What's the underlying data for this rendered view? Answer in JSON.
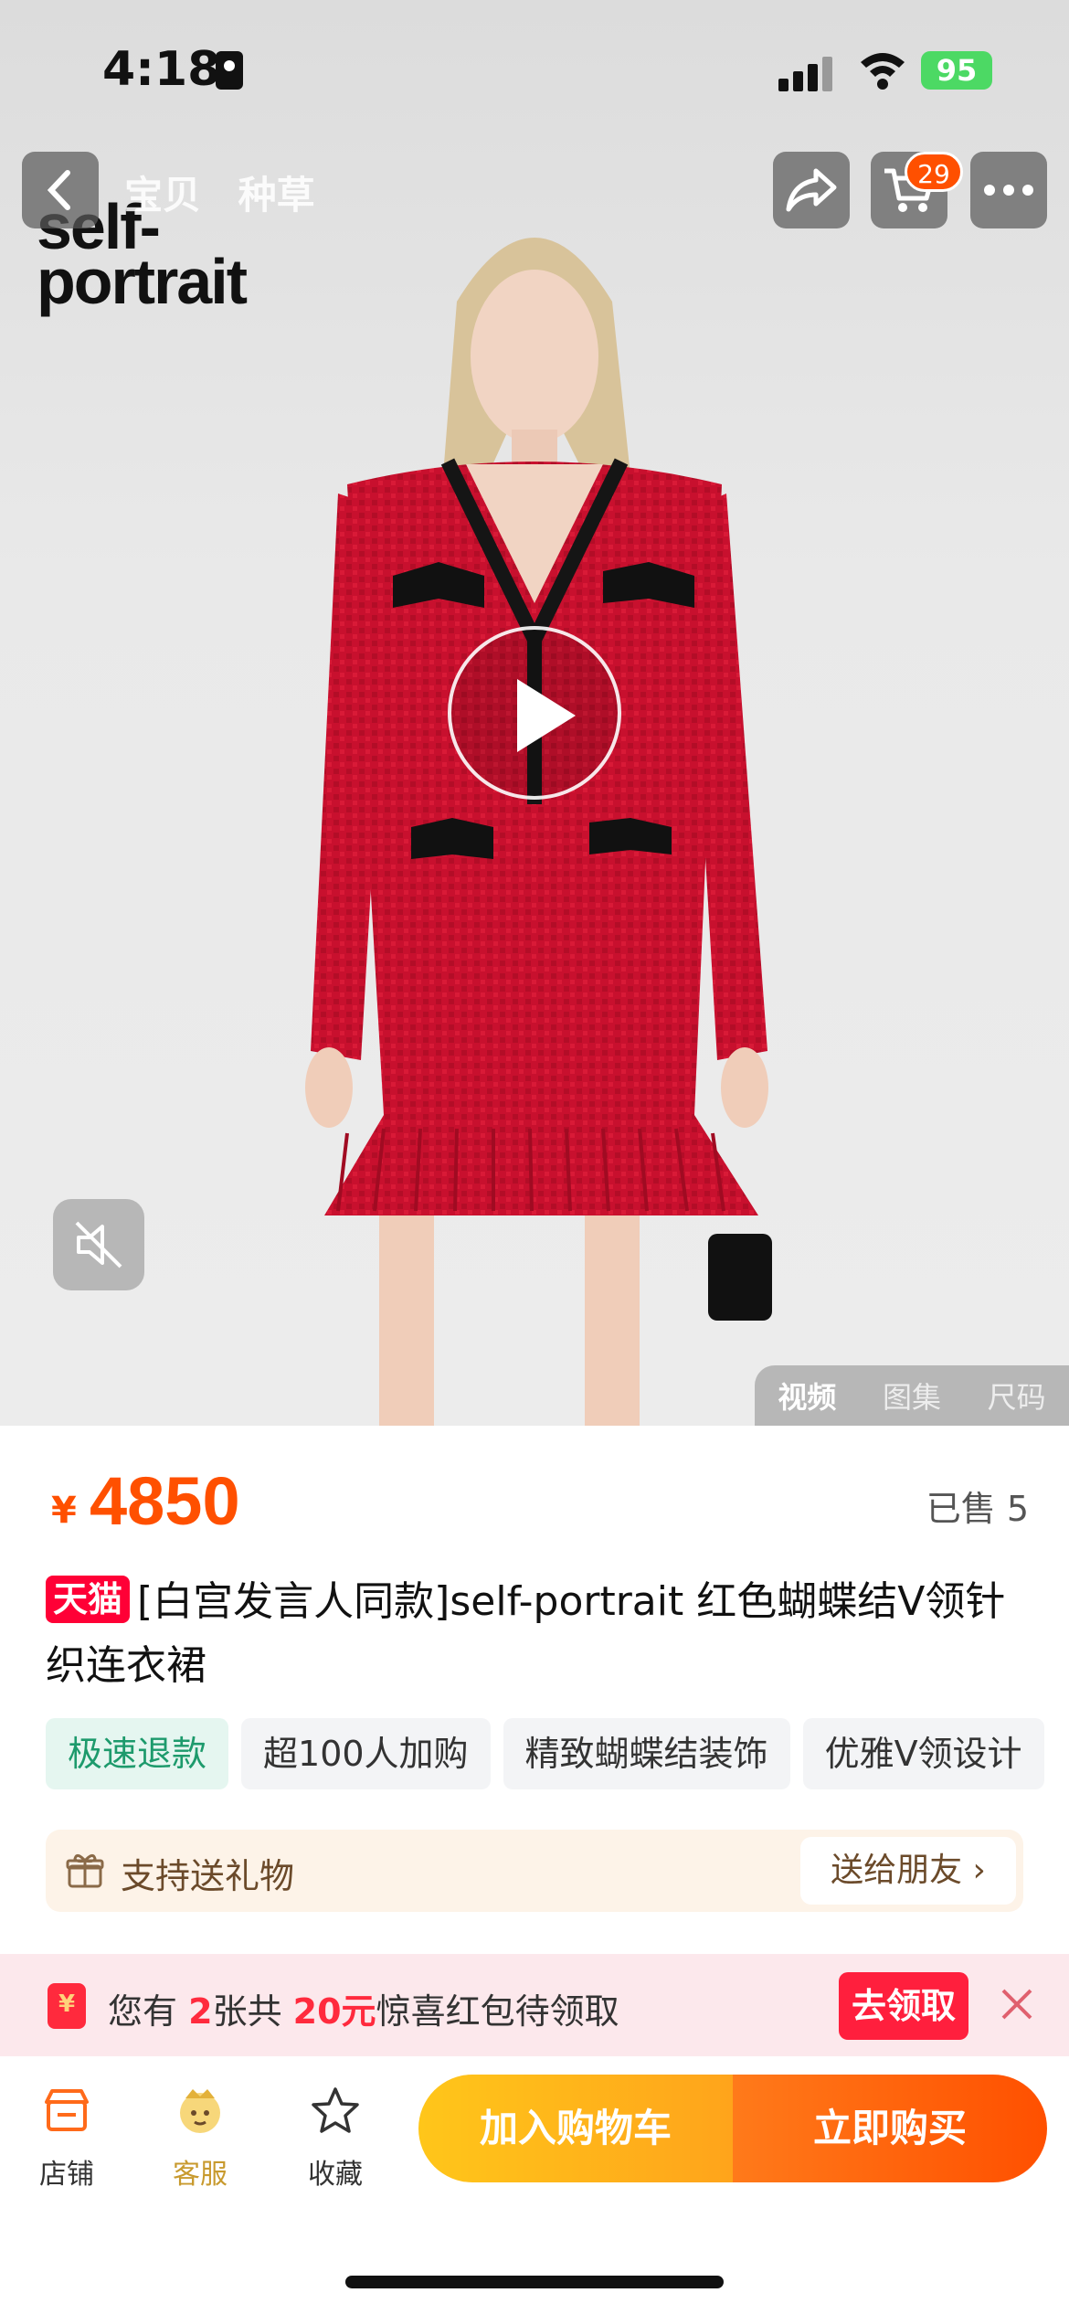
{
  "status_bar": {
    "time": "4:18",
    "battery": "95"
  },
  "header": {
    "tabs": [
      "宝贝",
      "种草"
    ],
    "brand_logo_line1": "self-",
    "brand_logo_line2": "portrait",
    "cart_badge": "29"
  },
  "media": {
    "tabs": [
      {
        "label": "视频",
        "active": true
      },
      {
        "label": "图集",
        "active": false
      },
      {
        "label": "尺码",
        "active": false
      }
    ]
  },
  "product": {
    "currency": "¥",
    "price": "4850",
    "sold": "已售 5",
    "store_tag": "天猫",
    "title": "[白宫发言人同款]self-portrait 红色蝴蝶结V领针织连衣裙",
    "tags": [
      "极速退款",
      "超100人加购",
      "精致蝴蝶结装饰",
      "优雅V领设计"
    ]
  },
  "gift": {
    "label": "支持送礼物",
    "button": "送给朋友 ›"
  },
  "coupon": {
    "text_prefix": "您有",
    "count": "2",
    "text_mid": "张共",
    "amount": "20元",
    "text_suffix": "惊喜红包待领取",
    "button": "去领取"
  },
  "bottom_bar": {
    "store": "店铺",
    "service": "客服",
    "favorite": "收藏",
    "add_to_cart": "加入购物车",
    "buy_now": "立即购买"
  },
  "colors": {
    "accent": "#ff5000",
    "tmall": "#ff0036",
    "coupon_red": "#ff1f3d",
    "dress_red": "#c8102e"
  }
}
